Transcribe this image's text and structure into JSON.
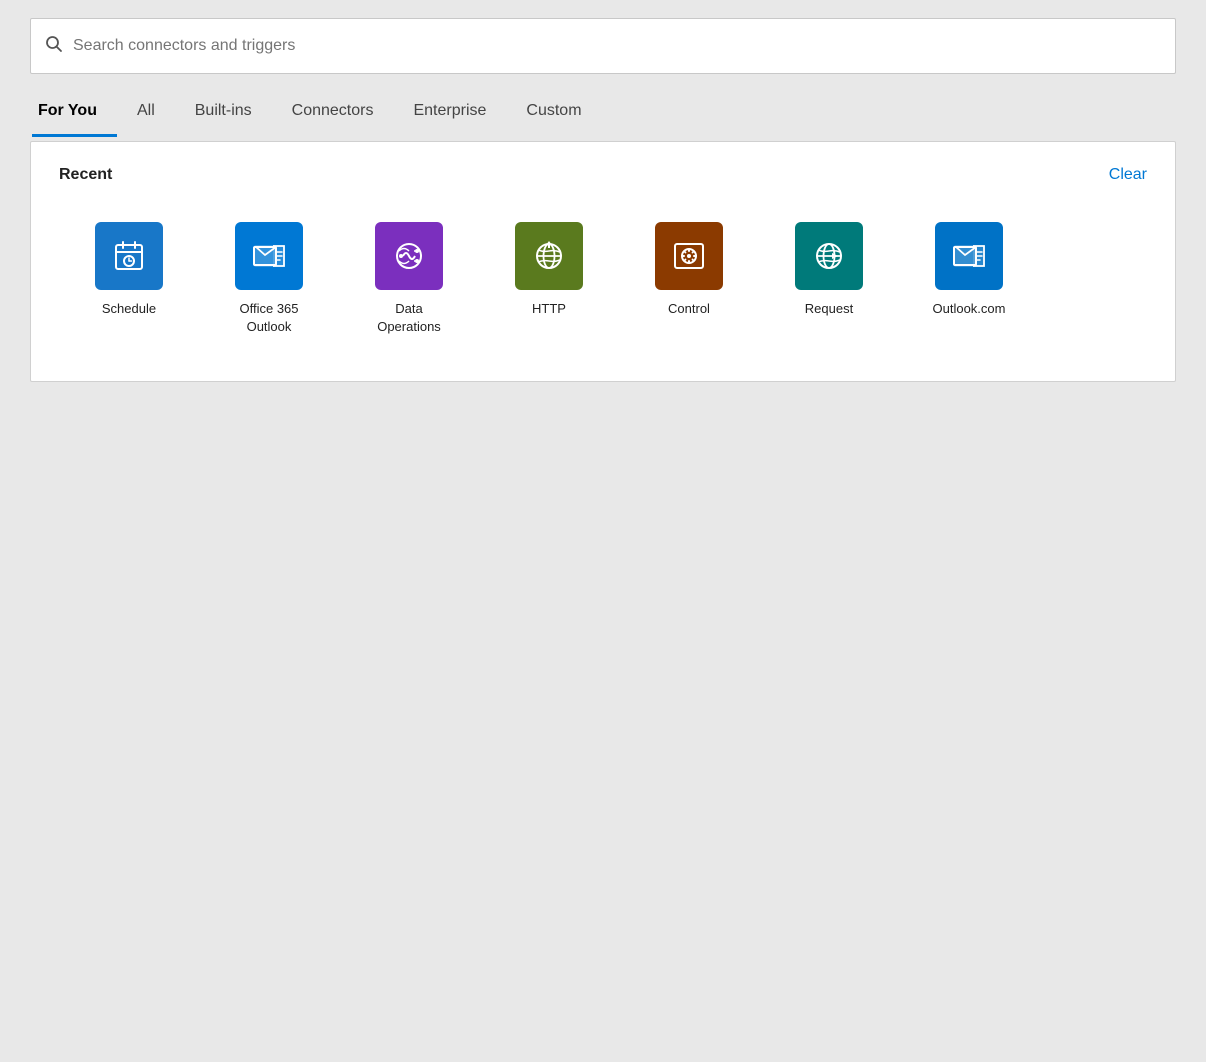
{
  "search": {
    "placeholder": "Search connectors and triggers"
  },
  "tabs": [
    {
      "id": "for-you",
      "label": "For You",
      "active": true
    },
    {
      "id": "all",
      "label": "All",
      "active": false
    },
    {
      "id": "built-ins",
      "label": "Built-ins",
      "active": false
    },
    {
      "id": "connectors",
      "label": "Connectors",
      "active": false
    },
    {
      "id": "enterprise",
      "label": "Enterprise",
      "active": false
    },
    {
      "id": "custom",
      "label": "Custom",
      "active": false
    }
  ],
  "recent": {
    "label": "Recent",
    "clear_label": "Clear"
  },
  "connectors": [
    {
      "id": "schedule",
      "name": "Schedule",
      "icon_class": "icon-schedule"
    },
    {
      "id": "office365-outlook",
      "name": "Office 365\nOutlook",
      "icon_class": "icon-office365"
    },
    {
      "id": "data-operations",
      "name": "Data\nOperations",
      "icon_class": "icon-data-ops"
    },
    {
      "id": "http",
      "name": "HTTP",
      "icon_class": "icon-http"
    },
    {
      "id": "control",
      "name": "Control",
      "icon_class": "icon-control"
    },
    {
      "id": "request",
      "name": "Request",
      "icon_class": "icon-request"
    },
    {
      "id": "outlookcom",
      "name": "Outlook.com",
      "icon_class": "icon-outlook"
    }
  ]
}
